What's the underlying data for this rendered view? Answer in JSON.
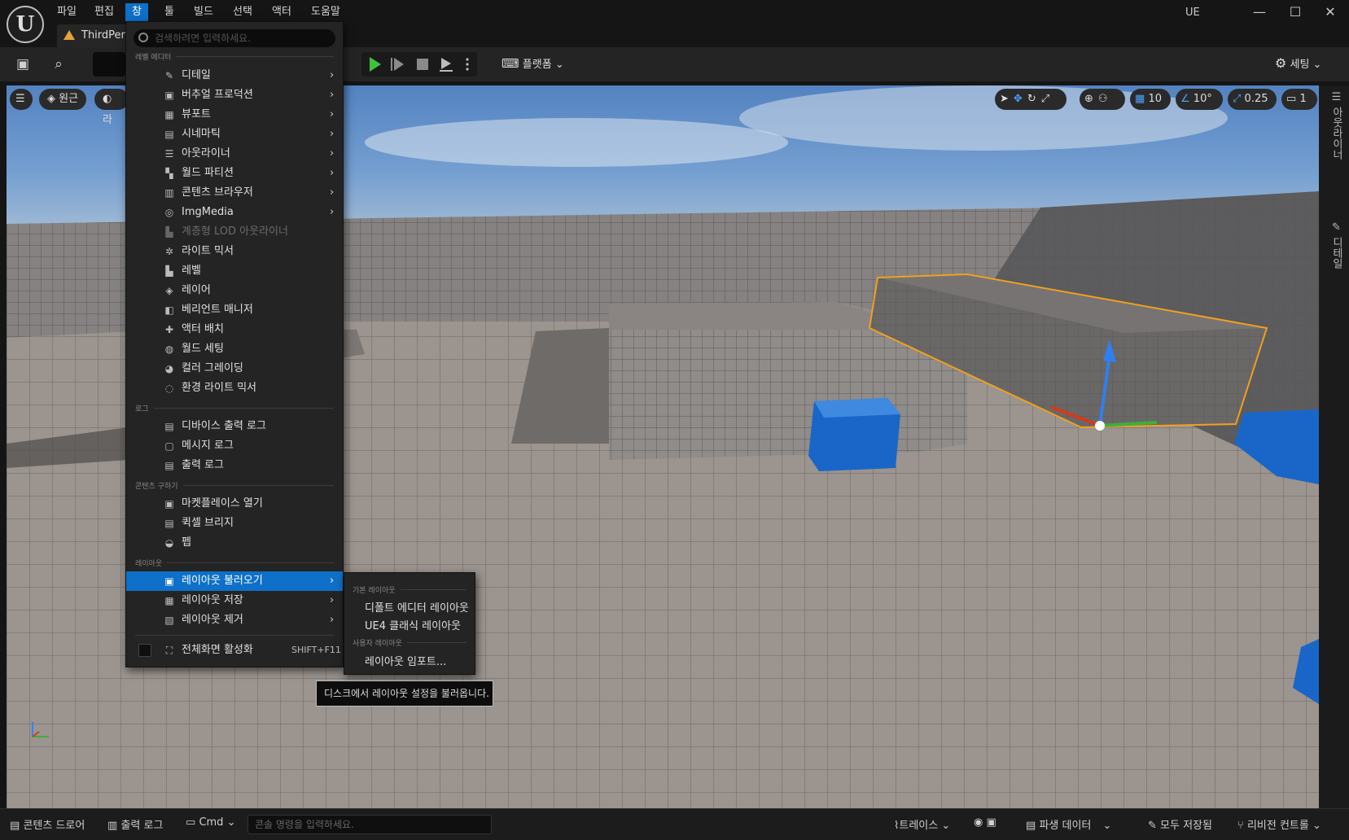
{
  "menubar": {
    "items": [
      "파일",
      "편집",
      "창",
      "툴",
      "빌드",
      "선택",
      "액터",
      "도움말"
    ],
    "active_index": 2
  },
  "window": {
    "product_label": "UE",
    "document_tab": "ThirdPers",
    "minimize_glyph": "—",
    "maximize_glyph": "☐",
    "close_glyph": "✕"
  },
  "toolbar": {
    "platform_label": "플랫폼",
    "settings_label": "세팅"
  },
  "viewport": {
    "perspective_label": "원근",
    "lit_label": "라",
    "grid_snap": "10",
    "rotation_snap": "10°",
    "scale_snap": "0.25",
    "camera_speed": "1"
  },
  "right_panel": {
    "outliner_tab": "아웃라이너",
    "details_tab": "디테일"
  },
  "window_menu": {
    "search_placeholder": "검색하려면 입력하세요.",
    "sections": {
      "level_editor": "레벨 에디터",
      "log": "로그",
      "get_content": "콘텐츠 구하기",
      "layout": "레이아웃"
    },
    "items": [
      {
        "label": "디테일",
        "submenu": true
      },
      {
        "label": "버추얼 프로덕션",
        "submenu": true
      },
      {
        "label": "뷰포트",
        "submenu": true
      },
      {
        "label": "시네마틱",
        "submenu": true
      },
      {
        "label": "아웃라이너",
        "submenu": true
      },
      {
        "label": "월드 파티션",
        "submenu": true
      },
      {
        "label": "콘텐츠 브라우저",
        "submenu": true
      },
      {
        "label": "ImgMedia",
        "submenu": true
      },
      {
        "label": "계층형 LOD 아웃라이너",
        "disabled": true
      },
      {
        "label": "라이트 믹서"
      },
      {
        "label": "레벨"
      },
      {
        "label": "레이어"
      },
      {
        "label": "베리언트 매니저"
      },
      {
        "label": "액터 배치"
      },
      {
        "label": "월드 세팅"
      },
      {
        "label": "컬러 그레이딩"
      },
      {
        "label": "환경 라이트 믹서"
      }
    ],
    "log_items": [
      "디바이스 출력 로그",
      "메시지 로그",
      "출력 로그"
    ],
    "content_items": [
      "마켓플레이스 열기",
      "퀵셀 브리지",
      "펩"
    ],
    "layout_items": [
      {
        "label": "레이아웃 불러오기",
        "highlighted": true
      },
      {
        "label": "레이아웃 저장"
      },
      {
        "label": "레이아웃 제거"
      }
    ],
    "fullscreen_label": "전체화면 활성화",
    "fullscreen_shortcut": "SHIFT+F11"
  },
  "load_layout_submenu": {
    "default_section": "기본 레이아웃",
    "default_items": [
      "디폴트 에디터 레이아웃",
      "UE4 클래식 레이아웃"
    ],
    "user_section": "사용자 레이아웃",
    "user_items": [
      "레이아웃 임포트..."
    ]
  },
  "tooltip": "디스크에서 레이아웃 설정을 불러옵니다.",
  "statusbar": {
    "content_drawer": "콘텐츠 드로어",
    "output_log": "출력 로그",
    "cmd": "Cmd",
    "console_placeholder": "콘솔 명령을 입력하세요.",
    "trace": "트레이스",
    "derived_data": "파생 데이터",
    "all_saved": "모두 저장됨",
    "revision_control": "리비전 컨트롤"
  },
  "colors": {
    "accent": "#0e70c8",
    "selection_outline": "#f0a020",
    "play_green": "#3cc23c",
    "cube_blue": "#1a66c8"
  }
}
